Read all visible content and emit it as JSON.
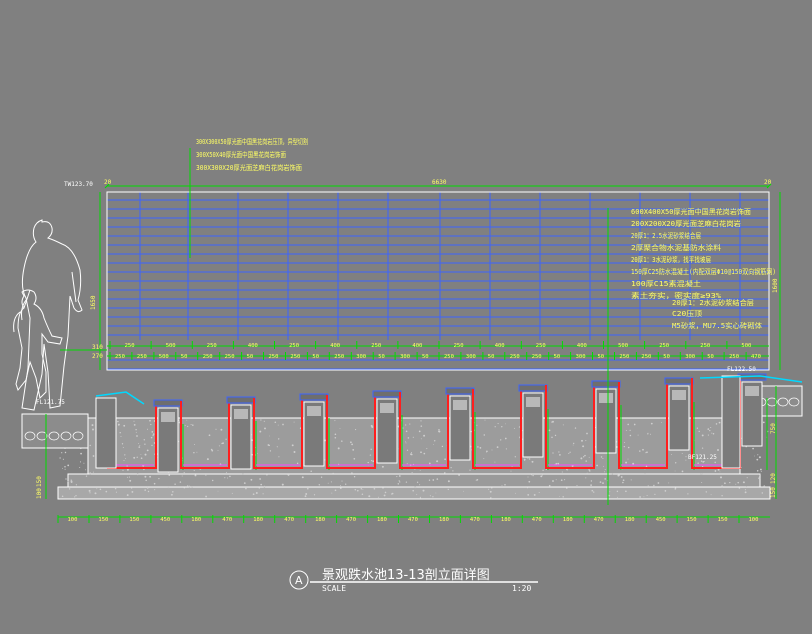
{
  "drawing": {
    "title": "景观跌水池13-13剖立面详图",
    "section_mark": "A",
    "scale_label": "SCALE",
    "scale_value": "1:20"
  },
  "annotations_top": [
    "300X300X50厚光面中国黑花岗岩压顶，异型切割",
    "300X50X40厚光面中国黑花岗岩饰面",
    "300X300X20厚光面芝麻白花岗岩饰面"
  ],
  "annotations_right": [
    "600X400X50厚光面中国黑花岗岩饰面",
    "200X200X20厚光面芝麻白花岗岩",
    "20厚1：2.5水泥砂浆结合层",
    "2厚聚合物水泥基防水涂料",
    "20厚1：3水泥砂浆，找平找坡层",
    "150厚C25防水混凝土(内配双层Φ10@150双向钢筋网)",
    "100厚C15素混凝土",
    "素土夯实，密实度≥93%",
    "20厚1：2水泥砂浆结合层",
    "C20压顶",
    "M5砂浆，MU7.5实心砖砌体"
  ],
  "elevations": {
    "top_left": "TW123.70",
    "ground_left": "FL121.75",
    "ground_right": "FL122.50",
    "pool_bottom": "BF121.25"
  },
  "top_dims": {
    "left": "20",
    "total": "6630",
    "right": "20"
  },
  "left_dims": [
    "1650",
    "310",
    "270"
  ],
  "right_dims": [
    "1600"
  ],
  "ruler_row1": [
    "250",
    "500",
    "250",
    "400",
    "250",
    "400",
    "250",
    "400",
    "250",
    "400",
    "250",
    "400",
    "500",
    "250",
    "250",
    "500"
  ],
  "ruler_row2": [
    "250",
    "250",
    "500",
    "50",
    "250",
    "250",
    "50",
    "250",
    "250",
    "50",
    "250",
    "300",
    "50",
    "300",
    "50",
    "250",
    "300",
    "50",
    "250",
    "250",
    "50",
    "300",
    "50",
    "250",
    "250",
    "50",
    "300",
    "50",
    "250",
    "470"
  ],
  "bottom_dims": [
    "100",
    "150",
    "150",
    "450",
    "180",
    "470",
    "180",
    "470",
    "180",
    "470",
    "180",
    "470",
    "180",
    "470",
    "180",
    "470",
    "180",
    "470",
    "180",
    "450",
    "150",
    "150",
    "100"
  ],
  "left_vertical_dims": [
    "150",
    "100"
  ],
  "right_vertical_dims": [
    "750",
    "120",
    "150"
  ],
  "colors": {
    "background": "#808080",
    "line_white": "#ffffff",
    "line_blue": "#3c64ff",
    "dim_green": "#00dc00",
    "waterproof_red": "#ff1e1e",
    "annotation_yellow": "#ffff64",
    "magenta": "#ff44ff",
    "cyan": "#00d8ff"
  }
}
